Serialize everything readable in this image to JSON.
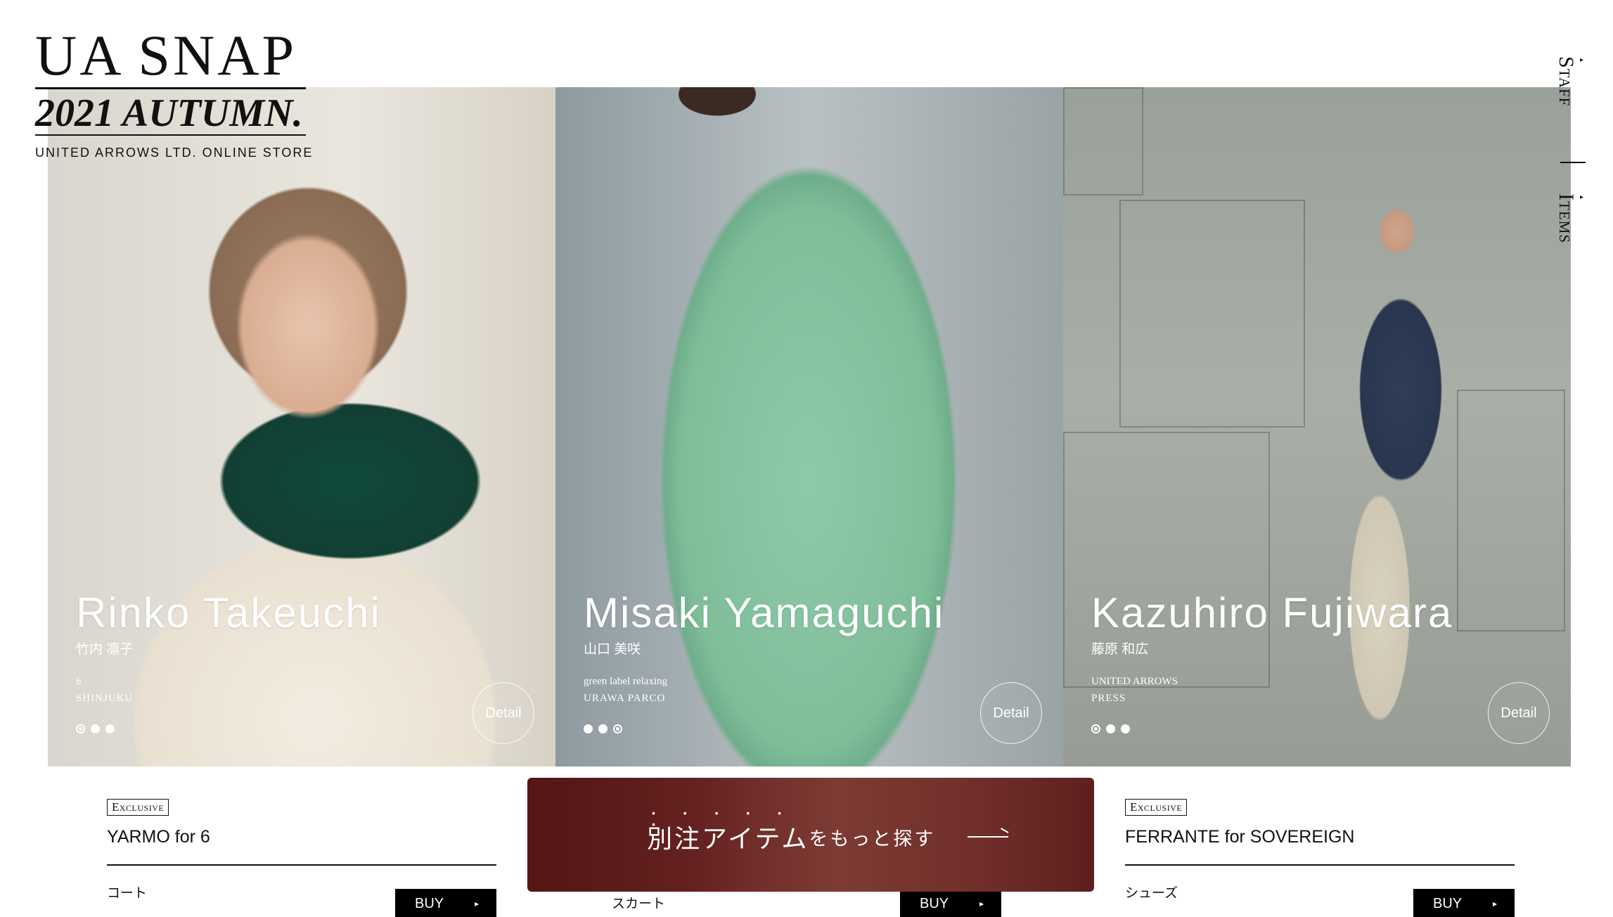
{
  "logo": {
    "title": "UA SNAP",
    "subtitle": "2021 AUTUMN.",
    "store": "UNITED ARROWS LTD. ONLINE STORE"
  },
  "side_nav": {
    "staff": "Staff",
    "items": "Items"
  },
  "panels": [
    {
      "name": "Rinko Takeuchi",
      "kana": "竹内 凛子",
      "brand": "6",
      "store": "SHINJUKU",
      "detail": "Detail",
      "dots_active_index": 0
    },
    {
      "name": "Misaki Yamaguchi",
      "kana": "山口 美咲",
      "brand": "green label relaxing",
      "store": "URAWA PARCO",
      "detail": "Detail",
      "dots_active_index": 2
    },
    {
      "name": "Kazuhiro Fujiwara",
      "kana": "藤原 和広",
      "brand": "UNITED ARROWS",
      "store": "PRESS",
      "detail": "Detail",
      "dots_active_index": 0
    }
  ],
  "items": [
    {
      "badge": "Exclusive",
      "name": "YARMO for 6",
      "category": "コート",
      "buy": "BUY",
      "arrow": "▸"
    },
    {
      "badge": "",
      "name": "",
      "category": "スカート",
      "buy": "BUY",
      "arrow": "▸"
    },
    {
      "badge": "Exclusive",
      "name": "FERRANTE for SOVEREIGN",
      "category": "シューズ",
      "buy": "BUY",
      "arrow": "▸"
    }
  ],
  "banner": {
    "main": "別注アイテム",
    "sub": "をもっと探す",
    "emphasis_dots": "• • • • • •"
  },
  "colors": {
    "banner": "#6a2826",
    "text": "#111111",
    "buy_bg": "#000000"
  }
}
